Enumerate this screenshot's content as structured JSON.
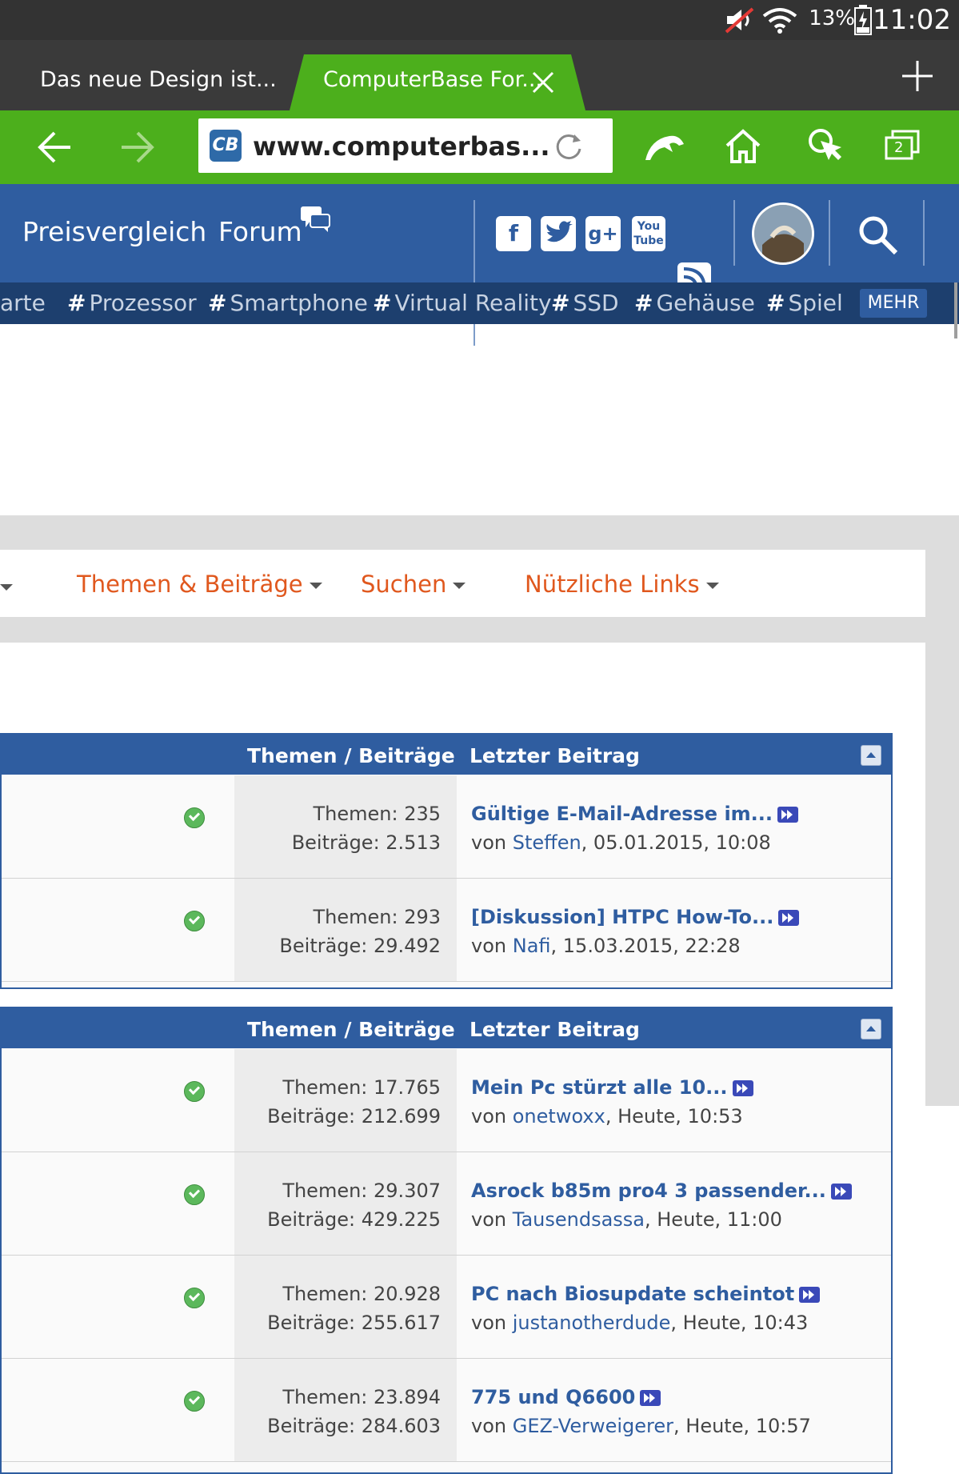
{
  "status_bar": {
    "battery_percent": "13%",
    "time": "11:02"
  },
  "tabs": [
    {
      "title": "Das neue Design ist..."
    },
    {
      "title": "ComputerBase For..."
    }
  ],
  "tab_count": "2",
  "url": "www.computerbas...",
  "site_nav": {
    "preisvergleich": "Preisvergleich",
    "forum": "Forum"
  },
  "social": {
    "facebook": "f",
    "googleplus": "g+",
    "youtube_top": "You",
    "youtube_bottom": "Tube"
  },
  "tags": [
    "arte",
    "Prozessor",
    "Smartphone",
    "Virtual Reality",
    "SSD",
    "Gehäuse",
    "Spiel"
  ],
  "tags_more": "MEHR",
  "forum_menu": {
    "themen": "Themen & Beiträge",
    "suchen": "Suchen",
    "links": "Nützliche Links"
  },
  "table_headers": {
    "stats": "Themen / Beiträge",
    "last": "Letzter Beitrag"
  },
  "table1": [
    {
      "themen": "Themen: 235",
      "beitraege": "Beiträge: 2.513",
      "last_title": "Gültige E-Mail-Adresse im...",
      "by_prefix": "von",
      "user": "Steffen",
      "date": ", 05.01.2015, 10:08"
    },
    {
      "themen": "Themen: 293",
      "beitraege": "Beiträge: 29.492",
      "last_title": "[Diskussion] HTPC How-To...",
      "by_prefix": "von",
      "user": "Nafi",
      "date": ", 15.03.2015, 22:28"
    }
  ],
  "table2": [
    {
      "themen": "Themen: 17.765",
      "beitraege": "Beiträge: 212.699",
      "last_title": "Mein Pc stürzt alle 10...",
      "by_prefix": "von",
      "user": "onetwoxx",
      "date": ", Heute, 10:53"
    },
    {
      "themen": "Themen: 29.307",
      "beitraege": "Beiträge: 429.225",
      "last_title": "Asrock b85m pro4 3 passender...",
      "by_prefix": "von",
      "user": "Tausendsassa",
      "date": ", Heute, 11:00"
    },
    {
      "themen": "Themen: 20.928",
      "beitraege": "Beiträge: 255.617",
      "last_title": "PC nach Biosupdate scheintot",
      "by_prefix": "von",
      "user": "justanotherdude",
      "date": ", Heute, 10:43"
    },
    {
      "themen": "Themen: 23.894",
      "beitraege": "Beiträge: 284.603",
      "last_title": "775 und Q6600",
      "by_prefix": "von",
      "user": "GEZ-Verweigerer",
      "date": ", Heute, 10:57"
    }
  ],
  "colors": {
    "browser_green": "#4caf1c",
    "site_blue": "#2f5da0",
    "menu_orange": "#e0581e"
  }
}
